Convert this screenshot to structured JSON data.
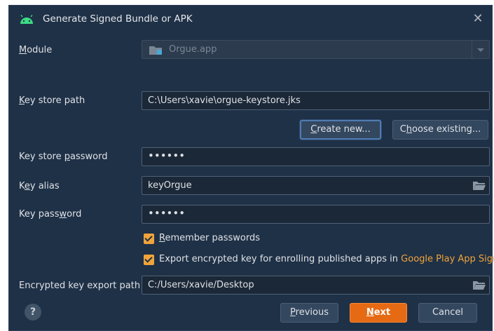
{
  "window": {
    "title": "Generate Signed Bundle or APK",
    "close_glyph": "✕",
    "icon": "android-icon"
  },
  "form": {
    "module": {
      "label_pre": "",
      "label_u": "M",
      "label_post": "odule",
      "value": "Orgue.app"
    },
    "key_store_path": {
      "label_pre": "",
      "label_u": "K",
      "label_post": "ey store path",
      "value": "C:\\Users\\xavie\\orgue-keystore.jks"
    },
    "create_new": {
      "label_pre": "",
      "label_u": "C",
      "label_post": "reate new..."
    },
    "choose_existing": {
      "label_pre": "C",
      "label_u": "h",
      "label_post": "oose existing..."
    },
    "key_store_password": {
      "label_pre": "Key store ",
      "label_u": "p",
      "label_post": "assword",
      "value": "••••••"
    },
    "key_alias": {
      "label_pre": "K",
      "label_u": "e",
      "label_post": "y alias",
      "value": "keyOrgue"
    },
    "key_password": {
      "label_pre": "Key pass",
      "label_u": "w",
      "label_post": "ord",
      "value": "••••••"
    },
    "remember_passwords": {
      "label_pre": "",
      "label_u": "R",
      "label_post": "emember passwords",
      "checked": true
    },
    "export_encrypted": {
      "label": "Export encrypted key for enrolling published apps in ",
      "link": "Google Play App Signing",
      "checked": true
    },
    "encrypted_key_export_path": {
      "label": "Encrypted key export path",
      "value": "C:/Users/xavie/Desktop"
    }
  },
  "footer": {
    "help": "?",
    "previous": {
      "label_pre": "",
      "label_u": "P",
      "label_post": "revious"
    },
    "next": {
      "label_pre": "",
      "label_u": "N",
      "label_post": "ext"
    },
    "cancel": "Cancel"
  },
  "colors": {
    "background": "#1f3147",
    "accent_orange": "#e66a14",
    "checkbox": "#f0a43a",
    "focus": "#4f7bb0"
  }
}
